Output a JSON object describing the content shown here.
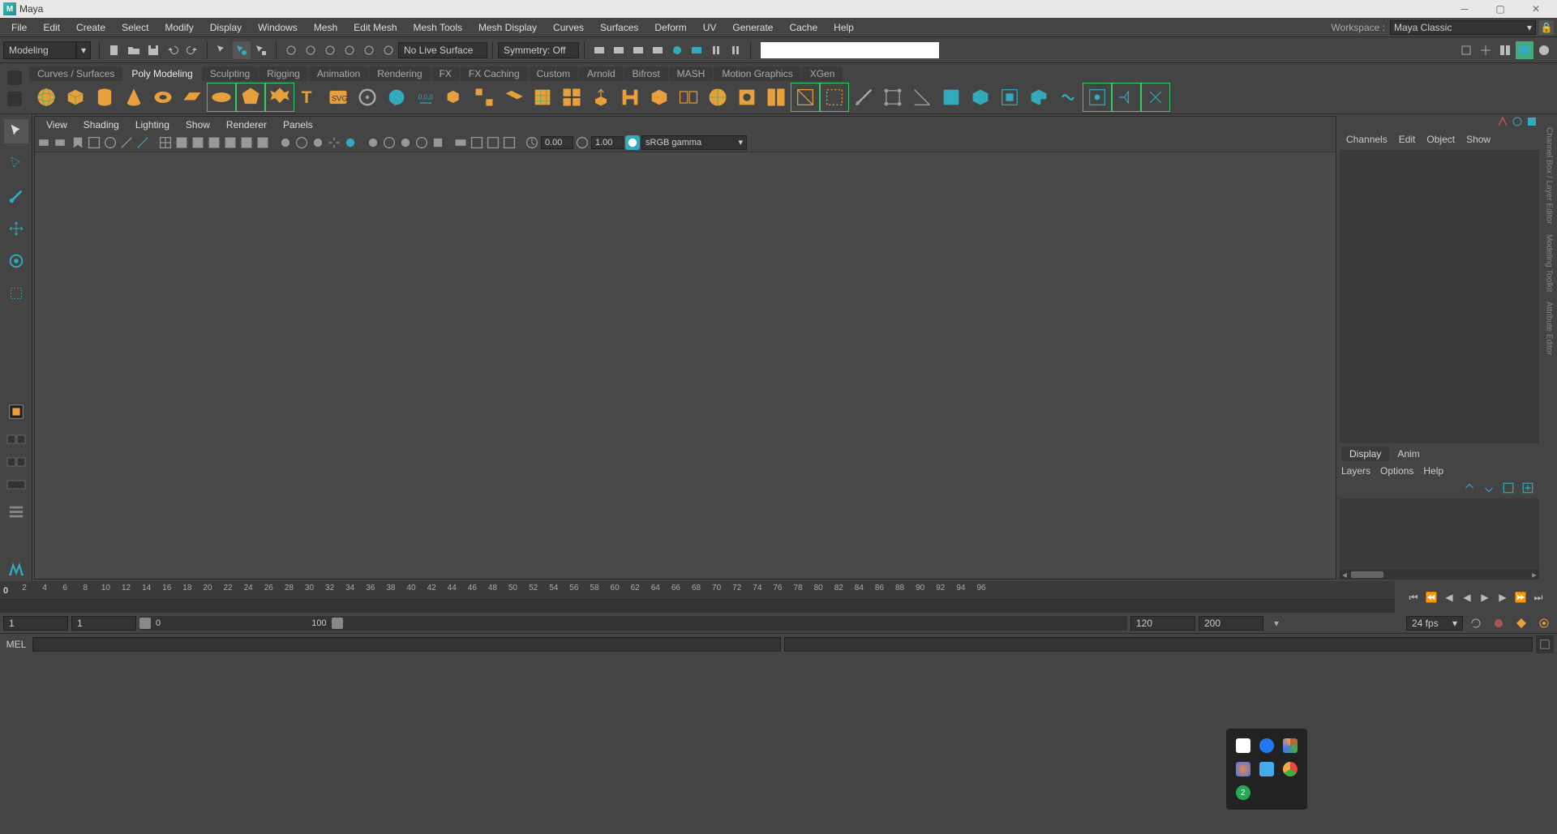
{
  "title": "Maya",
  "menubar": [
    "File",
    "Edit",
    "Create",
    "Select",
    "Modify",
    "Display",
    "Windows",
    "Mesh",
    "Edit Mesh",
    "Mesh Tools",
    "Mesh Display",
    "Curves",
    "Surfaces",
    "Deform",
    "UV",
    "Generate",
    "Cache",
    "Help"
  ],
  "workspace_label": "Workspace :",
  "workspace_value": "Maya Classic",
  "mode_select": "Modeling",
  "live_surface": "No Live Surface",
  "symmetry": "Symmetry: Off",
  "shelf_tabs": [
    "Curves / Surfaces",
    "Poly Modeling",
    "Sculpting",
    "Rigging",
    "Animation",
    "Rendering",
    "FX",
    "FX Caching",
    "Custom",
    "Arnold",
    "Bifrost",
    "MASH",
    "Motion Graphics",
    "XGen"
  ],
  "shelf_active": 1,
  "viewport_menus": [
    "View",
    "Shading",
    "Lighting",
    "Show",
    "Renderer",
    "Panels"
  ],
  "viewport_val_a": "0.00",
  "viewport_val_b": "1.00",
  "color_space": "sRGB gamma",
  "channel_tabs": [
    "Channels",
    "Edit",
    "Object",
    "Show"
  ],
  "layer_tabs": [
    "Display",
    "Anim"
  ],
  "layer_menus": [
    "Layers",
    "Options",
    "Help"
  ],
  "right_strip": [
    "Channel Box / Layer Editor",
    "Modeling Toolkit",
    "Attribute Editor"
  ],
  "time_current": "0",
  "time_ticks": [
    2,
    4,
    6,
    8,
    10,
    12,
    14,
    16,
    18,
    20,
    22,
    24,
    26,
    28,
    30,
    32,
    34,
    36,
    38,
    40,
    42,
    44,
    46,
    48,
    50,
    52,
    54,
    56,
    58,
    60,
    62,
    64,
    66,
    68,
    70,
    72,
    74,
    76,
    78,
    80,
    82,
    84,
    86,
    88,
    90,
    92,
    94,
    96
  ],
  "range_start": "1",
  "range_playstart": "1",
  "range_slider_start": "0",
  "range_slider_end": "100",
  "range_playend": "120",
  "range_end": "200",
  "fps": "24 fps",
  "mel_label": "MEL",
  "tray_badge": "2"
}
